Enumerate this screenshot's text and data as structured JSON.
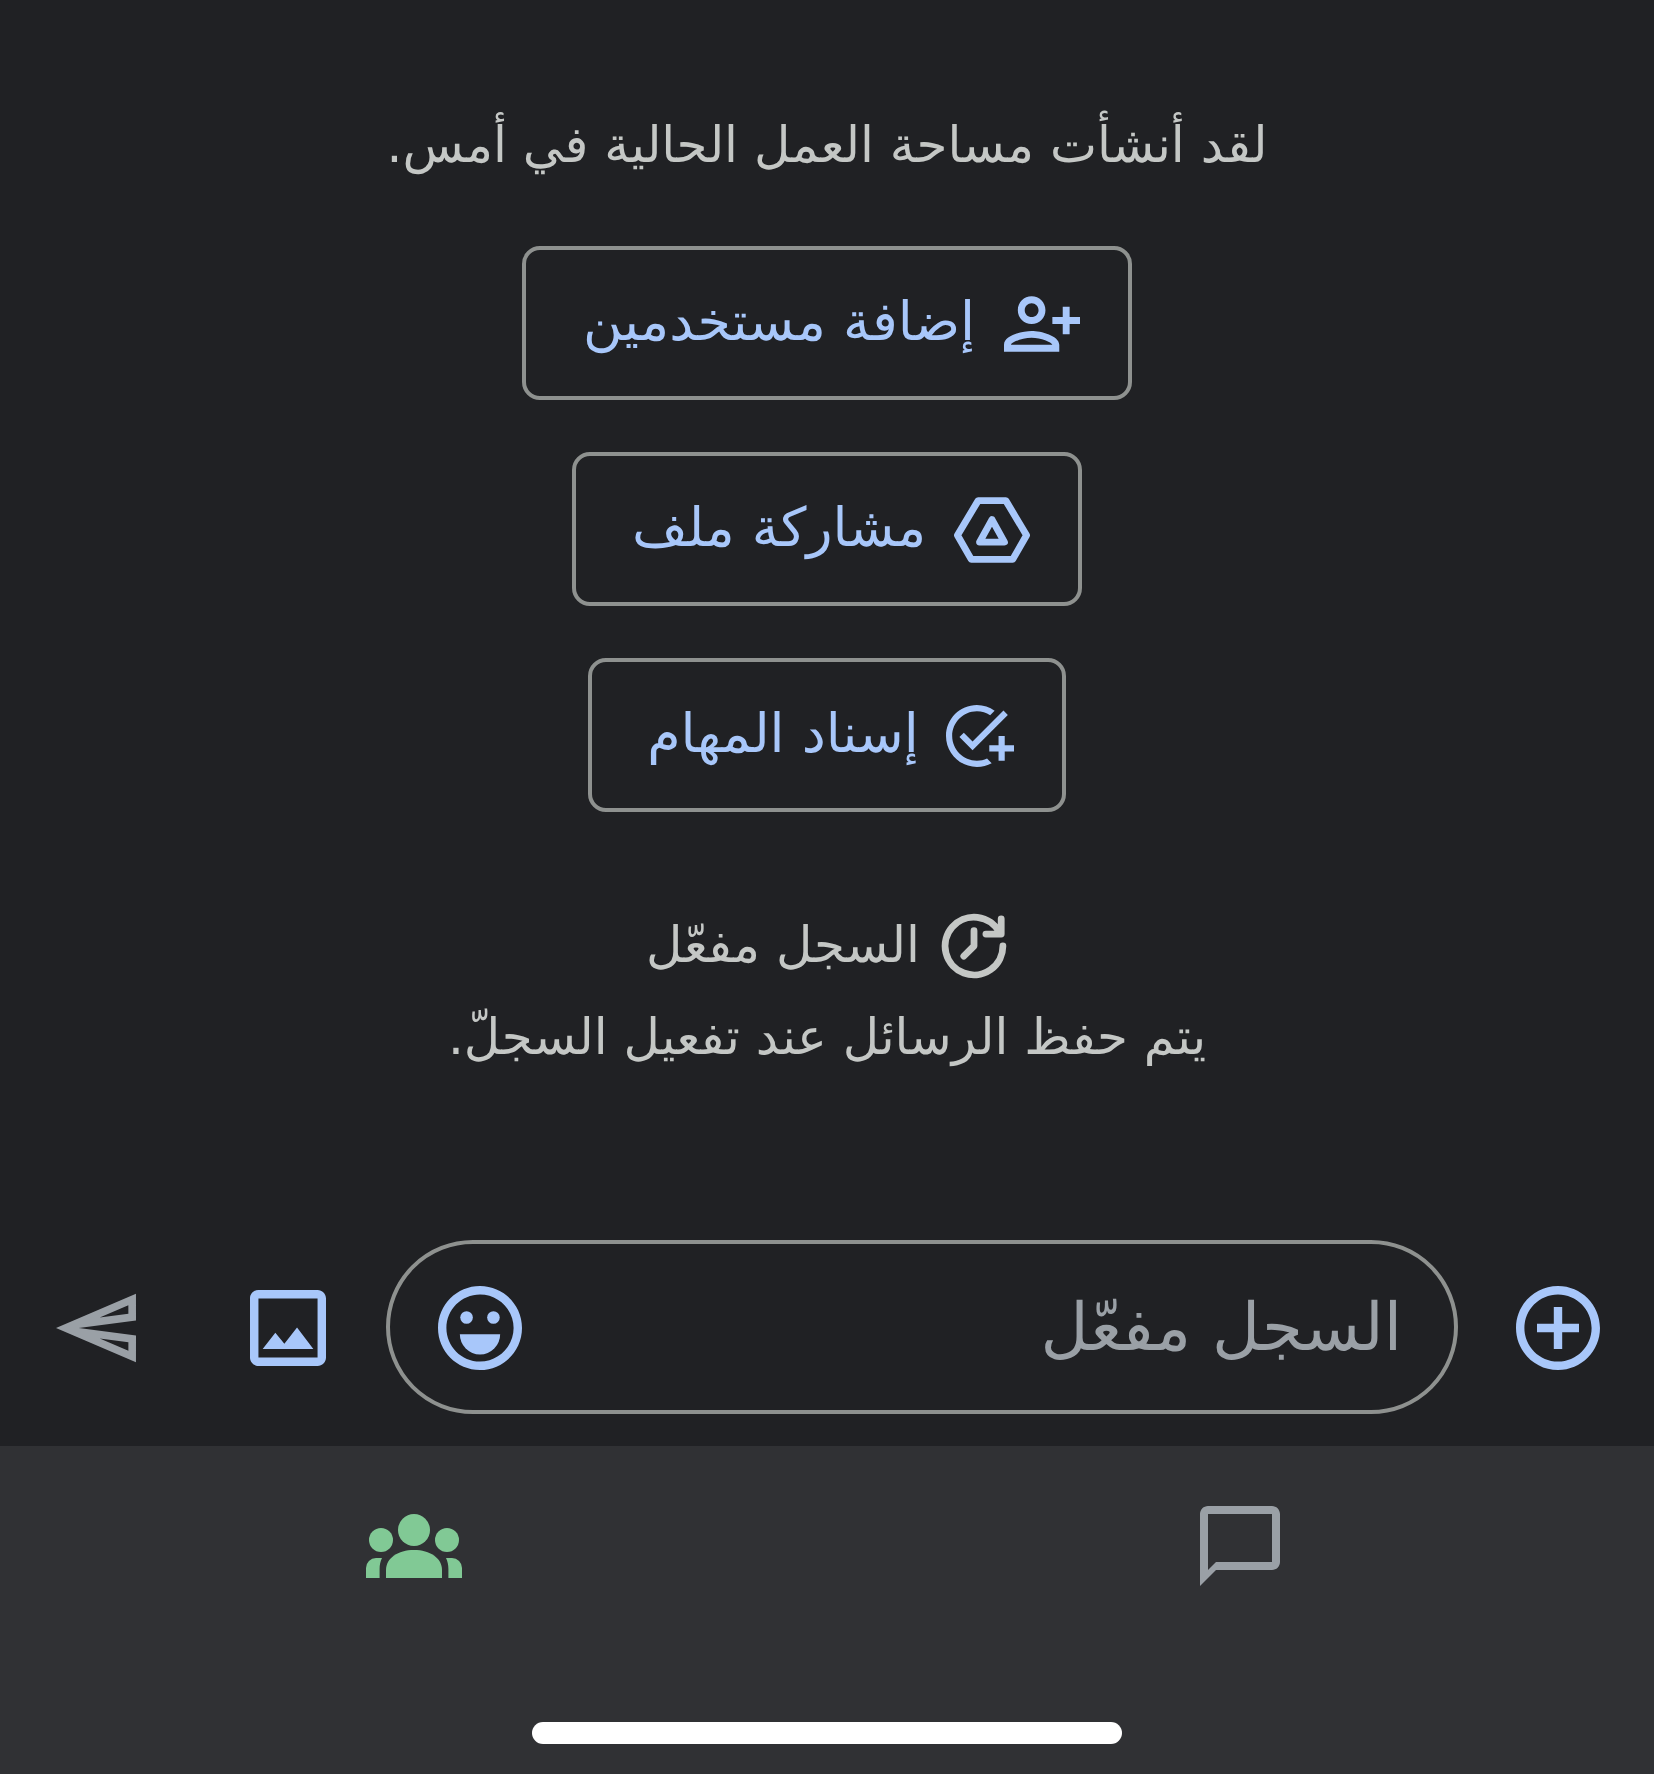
{
  "intro": "لقد أنشأت مساحة العمل الحالية في أمس.",
  "actions": [
    {
      "label": "إضافة مستخدمين"
    },
    {
      "label": "مشاركة ملف"
    },
    {
      "label": "إسناد المهام"
    }
  ],
  "history": {
    "label": "السجل مفعّل",
    "note": "يتم حفظ الرسائل عند تفعيل السجلّ."
  },
  "composer": {
    "placeholder": "السجل مفعّل"
  },
  "nav_tabs": [
    {
      "selected": false
    },
    {
      "selected": true
    }
  ]
}
